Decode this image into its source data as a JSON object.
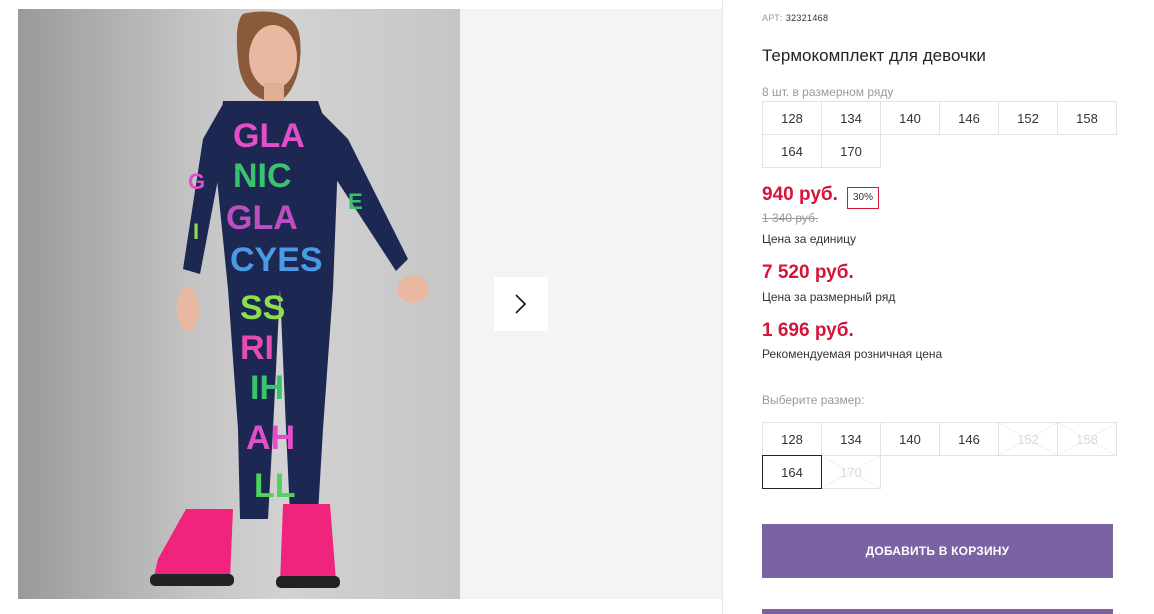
{
  "gallery": {
    "photo_alt": "",
    "next_icon": "chevron-right-icon"
  },
  "product": {
    "art_label": "АРТ:",
    "art_number": "32321468",
    "title": "Термокомплект для девочки",
    "pack_note": "8 шт. в размерном ряду",
    "pack_sizes": [
      "128",
      "134",
      "140",
      "146",
      "152",
      "158",
      "164",
      "170"
    ]
  },
  "prices": {
    "unit_price": "940 руб.",
    "discount": "30%",
    "old_price": "1 340 руб.",
    "unit_label": "Цена за единицу",
    "pack_price": "7 520 руб.",
    "pack_label": "Цена за размерный ряд",
    "retail_price": "1 696 руб.",
    "retail_label": "Рекомендуемая розничная цена"
  },
  "size_select": {
    "label": "Выберите размер:",
    "sizes": [
      {
        "value": "128",
        "available": true
      },
      {
        "value": "134",
        "available": true
      },
      {
        "value": "140",
        "available": true
      },
      {
        "value": "146",
        "available": true
      },
      {
        "value": "152",
        "available": false
      },
      {
        "value": "158",
        "available": false
      },
      {
        "value": "164",
        "available": true,
        "selected": true
      },
      {
        "value": "170",
        "available": false
      }
    ]
  },
  "actions": {
    "add_to_cart": "ДОБАВИТЬ В КОРЗИНУ"
  },
  "colors": {
    "accent": "#7b62a3",
    "price_red": "#d4143a"
  }
}
